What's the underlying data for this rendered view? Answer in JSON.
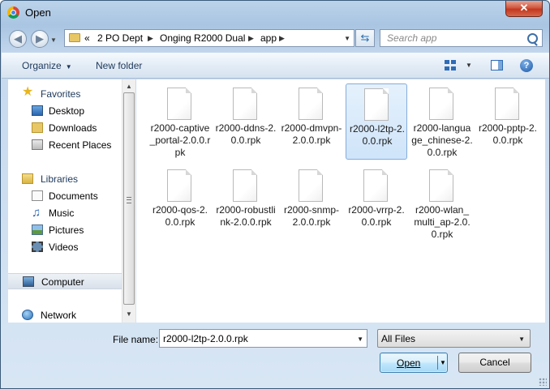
{
  "window": {
    "title": "Open",
    "close_glyph": "✕"
  },
  "address": {
    "overflow": "«",
    "crumbs": [
      "2 PO Dept",
      "Onging R2000 Dual",
      "app"
    ]
  },
  "search": {
    "placeholder": "Search app"
  },
  "toolbar": {
    "organize": "Organize",
    "new_folder": "New folder",
    "help_glyph": "?"
  },
  "nav": {
    "favorites": {
      "label": "Favorites",
      "items": [
        "Desktop",
        "Downloads",
        "Recent Places"
      ]
    },
    "libraries": {
      "label": "Libraries",
      "items": [
        "Documents",
        "Music",
        "Pictures",
        "Videos"
      ]
    },
    "computer": "Computer",
    "network": "Network"
  },
  "files": [
    "r2000-captive_portal-2.0.0.rpk",
    "r2000-ddns-2.0.0.rpk",
    "r2000-dmvpn-2.0.0.rpk",
    "r2000-l2tp-2.0.0.rpk",
    "r2000-language_chinese-2.0.0.rpk",
    "r2000-pptp-2.0.0.rpk",
    "r2000-qos-2.0.0.rpk",
    "r2000-robustlink-2.0.0.rpk",
    "r2000-snmp-2.0.0.rpk",
    "r2000-vrrp-2.0.0.rpk",
    "r2000-wlan_multi_ap-2.0.0.rpk"
  ],
  "selected_file_index": 3,
  "bottom": {
    "file_name_label": "File name:",
    "file_name_value": "r2000-l2tp-2.0.0.rpk",
    "file_type": "All Files",
    "open": "Open",
    "cancel": "Cancel"
  },
  "colors": {
    "accent": "#3c7fb1",
    "frame": "#a9c5e2",
    "selection": "#cfe4fa"
  }
}
